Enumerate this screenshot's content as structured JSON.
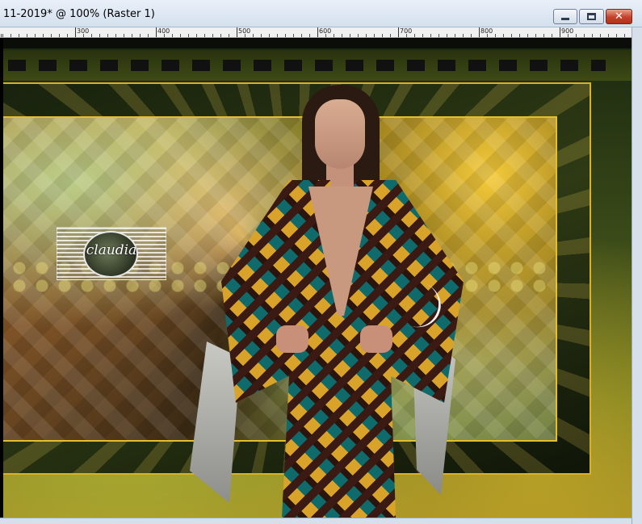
{
  "window": {
    "title": "11-2019* @ 100% (Raster 1)",
    "buttons": {
      "minimize": "minimize",
      "maximize": "maximize",
      "close": "✕"
    }
  },
  "ruler": {
    "ticks": [
      {
        "label": "300",
        "offset": 93
      },
      {
        "label": "400",
        "offset": 193
      },
      {
        "label": "500",
        "offset": 293
      },
      {
        "label": "600",
        "offset": 393
      },
      {
        "label": "700",
        "offset": 493
      },
      {
        "label": "800",
        "offset": 593
      },
      {
        "label": "900",
        "offset": 693
      }
    ]
  },
  "canvas": {
    "image": "fashion-model-collage",
    "watermark": {
      "text": "claudia"
    },
    "colors": {
      "frame_gold": "#e2bf2e",
      "teal": "#0f6a6b",
      "mustard": "#d9a32a"
    }
  }
}
